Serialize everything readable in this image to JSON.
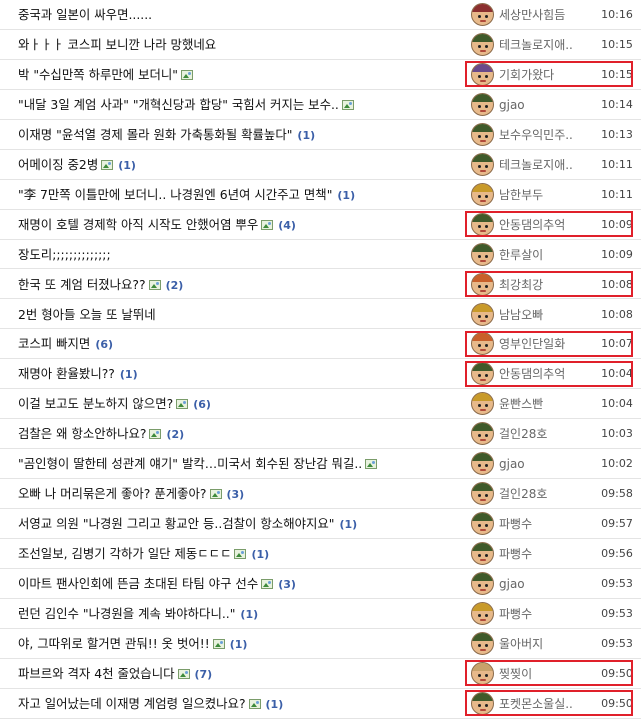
{
  "posts": [
    {
      "title": "중국과 일본이 싸우면......",
      "img": false,
      "comments": "",
      "author": "세상만사힘듬",
      "time": "10:16",
      "cap": "#8b2f2f",
      "hl": false
    },
    {
      "title": "와ㅏㅏㅏ 코스피 보니깐 나라 망했네요",
      "img": false,
      "comments": "",
      "author": "테크놀로지애..",
      "time": "10:15",
      "cap": "#3f5a2a",
      "hl": false
    },
    {
      "title": "박 \"수십만쪽 하루만에 보더니\"",
      "img": true,
      "comments": "",
      "author": "기회가왔다",
      "time": "10:15",
      "cap": "#6a4a8a",
      "hl": true
    },
    {
      "title": "\"내달 3일 계엄 사과\" \"개혁신당과 합당\" 국힘서 커지는 보수..",
      "img": true,
      "comments": "",
      "author": "gjao",
      "time": "10:14",
      "cap": "#3f5a2a",
      "hl": false
    },
    {
      "title": "이재명 \"윤석열 경제 몰라 원화 가축통화될 확률높다\"",
      "img": false,
      "comments": "(1)",
      "author": "보수우익민주..",
      "time": "10:13",
      "cap": "#3f5a2a",
      "hl": false
    },
    {
      "title": "어메이징 중2병",
      "img": true,
      "comments": "(1)",
      "author": "테크놀로지애..",
      "time": "10:11",
      "cap": "#3f5a2a",
      "hl": false
    },
    {
      "title": "\"李 7만쪽 이틀만에 보더니.. 나경원엔 6년여 시간주고 면책\"",
      "img": false,
      "comments": "(1)",
      "author": "남한부두",
      "time": "10:11",
      "cap": "#c89a2a",
      "hl": false
    },
    {
      "title": "재명이 호텔 경제학 아직 시작도 안했어염 뿌우",
      "img": true,
      "comments": "(4)",
      "author": "안동댐의추억",
      "time": "10:09",
      "cap": "#3f5a2a",
      "hl": true
    },
    {
      "title": "장도리;;;;;;;;;;;;;;",
      "img": false,
      "comments": "",
      "author": "한루살이",
      "time": "10:09",
      "cap": "#3f5a2a",
      "hl": false
    },
    {
      "title": "한국 또 계엄 터졌나요??",
      "img": true,
      "comments": "(2)",
      "author": "최강최강",
      "time": "10:08",
      "cap": "#c8602a",
      "hl": true
    },
    {
      "title": "2번 형아들 오늘 또 날뛰네",
      "img": false,
      "comments": "",
      "author": "남남오빠",
      "time": "10:08",
      "cap": "#c89a2a",
      "hl": false
    },
    {
      "title": "코스피 빠지면",
      "img": false,
      "comments": "(6)",
      "author": "영부인단일화",
      "time": "10:07",
      "cap": "#c8602a",
      "hl": true
    },
    {
      "title": "재명아 환율봤니??",
      "img": false,
      "comments": "(1)",
      "author": "안동댐의추억",
      "time": "10:04",
      "cap": "#3f5a2a",
      "hl": true
    },
    {
      "title": "이걸 보고도 분노하지 않으면?",
      "img": true,
      "comments": "(6)",
      "author": "윤빤스빤",
      "time": "10:04",
      "cap": "#c89a2a",
      "hl": false
    },
    {
      "title": "검찰은 왜 항소안하나요?",
      "img": true,
      "comments": "(2)",
      "author": "걸인28호",
      "time": "10:03",
      "cap": "#3f5a2a",
      "hl": false
    },
    {
      "title": "\"곰인형이 딸한테 성관계 얘기\" 발칵…미국서 회수된 장난감 뭐길..",
      "img": true,
      "comments": "",
      "author": "gjao",
      "time": "10:02",
      "cap": "#3f5a2a",
      "hl": false
    },
    {
      "title": "오빠 나 머리묶은게 좋아? 푼게좋아?",
      "img": true,
      "comments": "(3)",
      "author": "걸인28호",
      "time": "09:58",
      "cap": "#3f5a2a",
      "hl": false
    },
    {
      "title": "서영교 의원 \"나경원 그리고 황교안 등..검찰이 항소해야지요\"",
      "img": false,
      "comments": "(1)",
      "author": "파뻥수",
      "time": "09:57",
      "cap": "#3f5a2a",
      "hl": false
    },
    {
      "title": "조선일보, 김병기 각하가 일단 제동ㄷㄷㄷ",
      "img": true,
      "comments": "(1)",
      "author": "파뻥수",
      "time": "09:56",
      "cap": "#3f5a2a",
      "hl": false
    },
    {
      "title": "이마트 팬사인회에 뜬금 초대된 타팀 야구 선수",
      "img": true,
      "comments": "(3)",
      "author": "gjao",
      "time": "09:53",
      "cap": "#3f5a2a",
      "hl": false
    },
    {
      "title": "런던 김인수 \"나경원을 계속 봐야하다니..\"",
      "img": false,
      "comments": "(1)",
      "author": "파뻥수",
      "time": "09:53",
      "cap": "#c89a2a",
      "hl": false
    },
    {
      "title": "야, 그따위로 할거면 관둬!! 옷 벗어!!",
      "img": true,
      "comments": "(1)",
      "author": "울아버지",
      "time": "09:53",
      "cap": "#3f5a2a",
      "hl": false
    },
    {
      "title": "파브르와 격자 4천 줄었습니다",
      "img": true,
      "comments": "(7)",
      "author": "찢찢이",
      "time": "09:50",
      "cap": "#c8a26a",
      "hl": true
    },
    {
      "title": "자고 일어났는데 이재명 계엄령 일으켰나요?",
      "img": true,
      "comments": "(1)",
      "author": "포켓몬소울실..",
      "time": "09:50",
      "cap": "#3f5a2a",
      "hl": true
    }
  ]
}
